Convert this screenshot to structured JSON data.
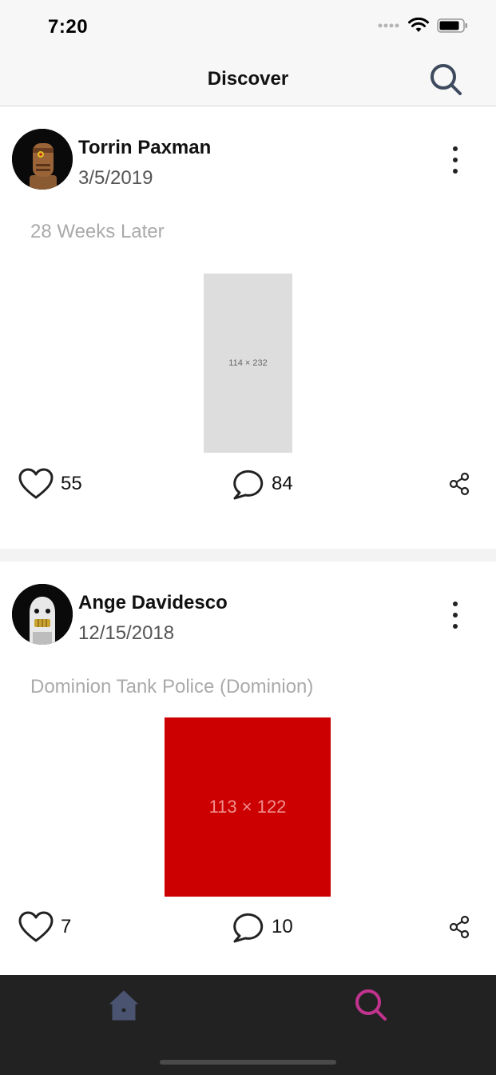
{
  "status_bar": {
    "time": "7:20"
  },
  "nav": {
    "title": "Discover"
  },
  "posts": [
    {
      "author": "Torrin Paxman",
      "date": "3/5/2019",
      "title": "28 Weeks Later",
      "image_label": "114 × 232",
      "image_color": "#dddddd",
      "likes": "55",
      "comments": "84"
    },
    {
      "author": "Ange Davidesco",
      "date": "12/15/2018",
      "title": "Dominion Tank Police (Dominion)",
      "image_label": "113 × 122",
      "image_color": "#cc0000",
      "likes": "7",
      "comments": "10"
    }
  ],
  "tab_bar": {
    "items": [
      {
        "icon": "home-icon",
        "active": false,
        "color": "#4a5470"
      },
      {
        "icon": "search-icon",
        "active": true,
        "color": "#c2338f"
      }
    ]
  },
  "colors": {
    "accent_active_tab": "#c2338f",
    "inactive_tab": "#4a5470",
    "tab_bar_background": "#222223"
  }
}
